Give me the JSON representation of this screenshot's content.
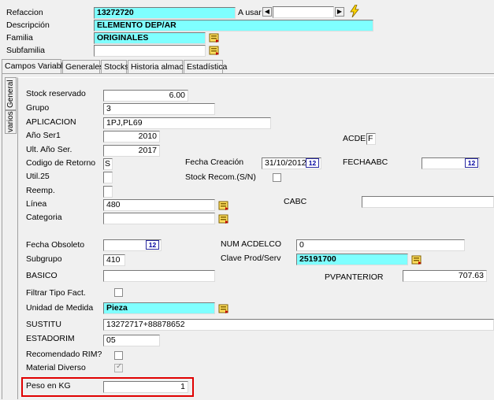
{
  "header": {
    "refaccion_label": "Refaccion",
    "refaccion_value": "13272720",
    "a_usar_label": "A usar",
    "descripcion_label": "Descripción",
    "descripcion_value": "ELEMENTO DEP/AR",
    "familia_label": "Familia",
    "familia_value": "ORIGINALES",
    "subfamilia_label": "Subfamilia",
    "subfamilia_value": ""
  },
  "tabs": [
    "Campos Variables",
    "Generales",
    "Stocks",
    "Historia almacén",
    "Estadística"
  ],
  "side_tabs": [
    "General",
    "varios"
  ],
  "fields": {
    "stock_reservado": {
      "label": "Stock reservado",
      "value": "6.00"
    },
    "grupo": {
      "label": "Grupo",
      "value": "3"
    },
    "aplicacion": {
      "label": "APLICACION",
      "value": "1PJ,PL69"
    },
    "anio_ser1": {
      "label": "Año Ser1",
      "value": "2010"
    },
    "ult_anio_ser": {
      "label": "Ult. Año Ser.",
      "value": "2017"
    },
    "codigo_retorno": {
      "label": "Codigo de Retorno",
      "value": "S"
    },
    "util25": {
      "label": "Util.25",
      "value": ""
    },
    "reemp": {
      "label": "Reemp.",
      "value": ""
    },
    "linea": {
      "label": "Línea",
      "value": "480"
    },
    "categoria": {
      "label": "Categoria",
      "value": ""
    },
    "fecha_obsoleto": {
      "label": "Fecha Obsoleto",
      "value": ""
    },
    "subgrupo": {
      "label": "Subgrupo",
      "value": "410"
    },
    "basico": {
      "label": "BASICO",
      "value": ""
    },
    "filtrar_tipo_fact": {
      "label": "Filtrar Tipo Fact."
    },
    "unidad_medida": {
      "label": "Unidad de Medida",
      "value": "Pieza"
    },
    "sustitu": {
      "label": "SUSTITU",
      "value": "13272717+88878652"
    },
    "estadorim": {
      "label": "ESTADORIM",
      "value": "05"
    },
    "recomendado_rim": {
      "label": "Recomendado RIM?"
    },
    "material_diverso": {
      "label": "Material Diverso",
      "checked": true
    },
    "peso_kg": {
      "label": "Peso en KG",
      "value": "1"
    },
    "acdel": {
      "label": "ACDEL",
      "value": "F"
    },
    "fecha_creacion": {
      "label": "Fecha Creación",
      "value": "31/10/2012"
    },
    "fechaabc": {
      "label": "FECHAABC",
      "value": ""
    },
    "stock_recom": {
      "label": "Stock Recom.(S/N)"
    },
    "cabc": {
      "label": "CABC",
      "value": ""
    },
    "num_acdelco": {
      "label": "NUM ACDELCO",
      "value": "0"
    },
    "clave_prod_serv": {
      "label": "Clave Prod/Serv",
      "value": "25191700"
    },
    "pvpanterior": {
      "label": "PVPANTERIOR",
      "value": "707.63"
    }
  },
  "calendar_icon_text": "12",
  "colors": {
    "highlight": "#7fffff",
    "annotation_box": "#e00000"
  }
}
